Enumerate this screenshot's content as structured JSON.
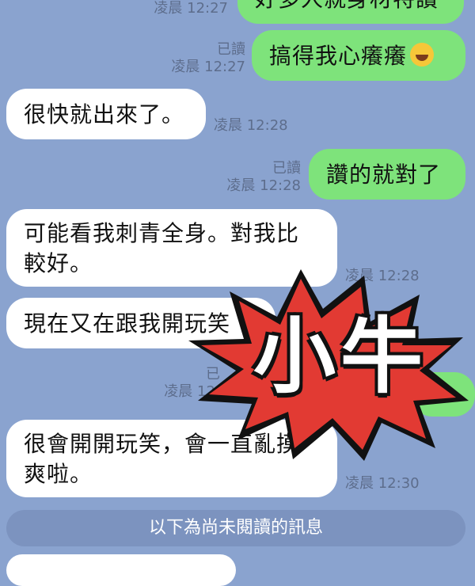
{
  "messages": [
    {
      "text": "好多人就身材特讚",
      "time": "凌晨 12:27"
    },
    {
      "text": "搞得我心癢癢",
      "read": "已讀",
      "time": "凌晨 12:27",
      "emoji": "grinning-sweat-emoji"
    },
    {
      "text": "很快就出來了。",
      "time": "凌晨 12:28"
    },
    {
      "text": "讚的就對了",
      "read": "已讀",
      "time": "凌晨 12:28"
    },
    {
      "text": "可能看我刺青全身。對我比較好。",
      "time": "凌晨 12:28"
    },
    {
      "text": "現在又在跟我開玩笑",
      "time": ""
    },
    {
      "read": "已",
      "time": "凌晨 12:"
    },
    {
      "text": "很會開開玩笑，會一直亂摸爽啦。",
      "time": "凌晨 12:30"
    }
  ],
  "divider": "以下為尚未閱讀的訊息",
  "sticker": {
    "text": "小牛",
    "color": "#e23a33"
  }
}
